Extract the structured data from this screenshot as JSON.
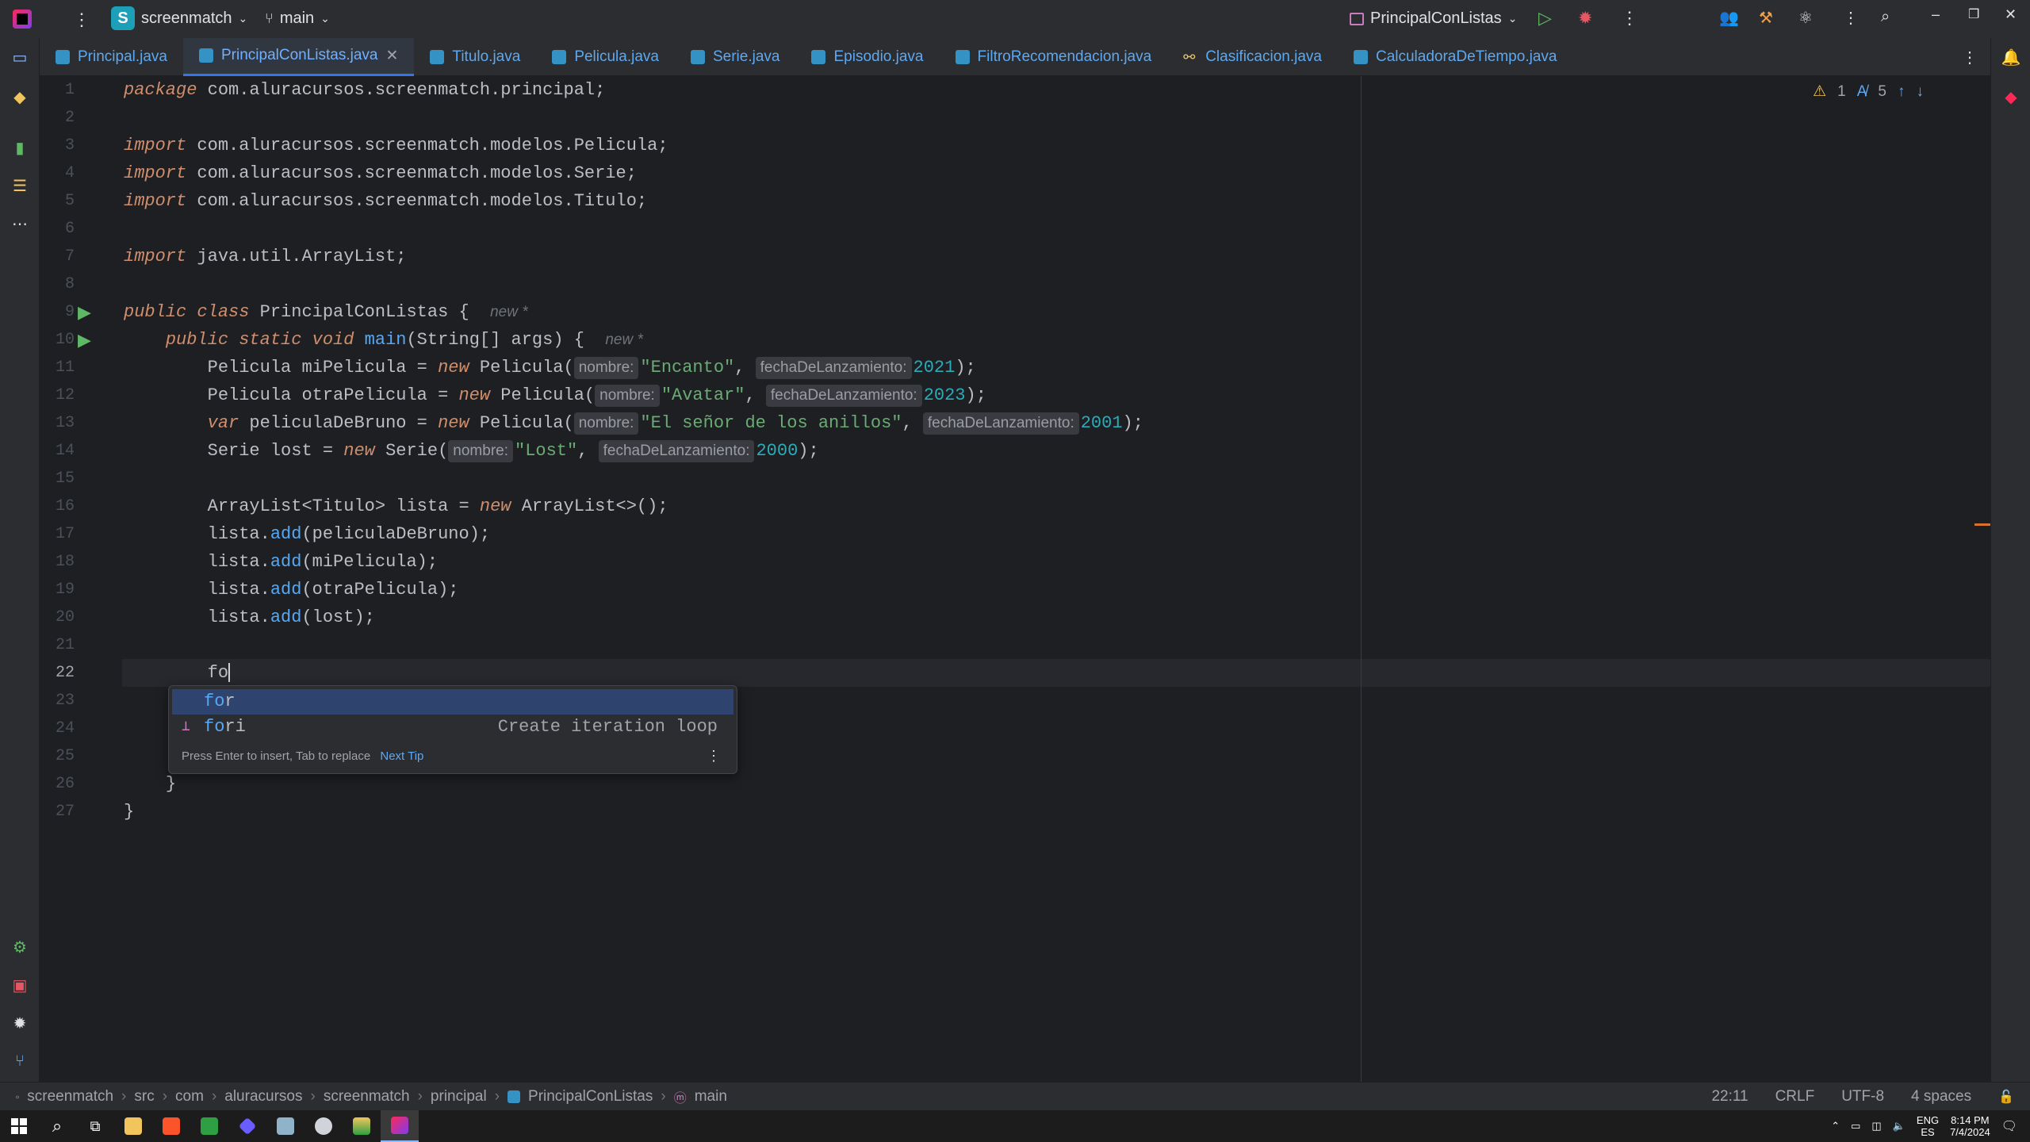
{
  "titlebar": {
    "project_initial": "S",
    "project_name": "screenmatch",
    "branch": "main",
    "run_config": "PrincipalConListas"
  },
  "tabs": [
    {
      "label": "Principal.java"
    },
    {
      "label": "PrincipalConListas.java"
    },
    {
      "label": "Titulo.java"
    },
    {
      "label": "Pelicula.java"
    },
    {
      "label": "Serie.java"
    },
    {
      "label": "Episodio.java"
    },
    {
      "label": "FiltroRecomendacion.java"
    },
    {
      "label": "Clasificacion.java"
    },
    {
      "label": "CalculadoraDeTiempo.java"
    }
  ],
  "inspections": {
    "warnings": "1",
    "typos": "5"
  },
  "lines": {
    "n": [
      "1",
      "2",
      "3",
      "4",
      "5",
      "6",
      "7",
      "8",
      "9",
      "10",
      "11",
      "12",
      "13",
      "14",
      "15",
      "16",
      "17",
      "18",
      "19",
      "20",
      "21",
      "22",
      "23",
      "24",
      "25",
      "26",
      "27"
    ],
    "l1a": "package",
    "l1b": " com.aluracursos.screenmatch.principal;",
    "import": "import",
    "l3": " com.aluracursos.screenmatch.modelos.Pelicula;",
    "l4": " com.aluracursos.screenmatch.modelos.Serie;",
    "l5": " com.aluracursos.screenmatch.modelos.Titulo;",
    "l7": " java.util.ArrayList;",
    "public": "public",
    "class": "class",
    "l9name": "PrincipalConListas {",
    "new_hint": "new *",
    "static": "static",
    "void": "void",
    "main": "main",
    "l10rest": "(String[] args) {",
    "new": "new",
    "var": "var",
    "l11a": "Pelicula miPelicula = ",
    "l11b": " Pelicula(",
    "hint_nombre": "nombre:",
    "hint_fecha": "fechaDeLanzamiento:",
    "s_encanto": "\"Encanto\"",
    "n2021": "2021",
    "l12a": "Pelicula otraPelicula = ",
    "s_avatar": "\"Avatar\"",
    "n2023": "2023",
    "l13a": " peliculaDeBruno = ",
    "s_senor": "\"El señor de los anillos\"",
    "n2001": "2001",
    "l14a": "Serie lost = ",
    "l14b": " Serie(",
    "s_lost": "\"Lost\"",
    "n2000": "2000",
    "comma": ", ",
    "close": ");",
    "l16a": "ArrayList<Titulo> lista = ",
    "l16b": " ArrayList<>();",
    "add": "add",
    "lista": "lista.",
    "l17": "(peliculaDeBruno);",
    "l18": "(miPelicula);",
    "l19": "(otraPelicula);",
    "l20": "(lost);",
    "l22": "fo",
    "brace": "}"
  },
  "completion": {
    "items": [
      {
        "match": "fo",
        "rest": "r",
        "desc": ""
      },
      {
        "match": "fo",
        "rest": "ri",
        "desc": "Create iteration loop"
      }
    ],
    "footer": "Press Enter to insert, Tab to replace",
    "tip": "Next Tip"
  },
  "breadcrumb": [
    "screenmatch",
    "src",
    "com",
    "aluracursos",
    "screenmatch",
    "principal",
    "PrincipalConListas",
    "main"
  ],
  "status": {
    "position": "22:11",
    "line_sep": "CRLF",
    "encoding": "UTF-8",
    "indent": "4 spaces"
  },
  "tray": {
    "lang1": "ENG",
    "lang2": "ES",
    "time": "8:14 PM",
    "date": "7/4/2024"
  },
  "colors": {
    "accent": "#3574f0",
    "keyword": "#cf8e6d",
    "string": "#6aab73",
    "number": "#2aacb8",
    "function": "#56a8f5"
  }
}
